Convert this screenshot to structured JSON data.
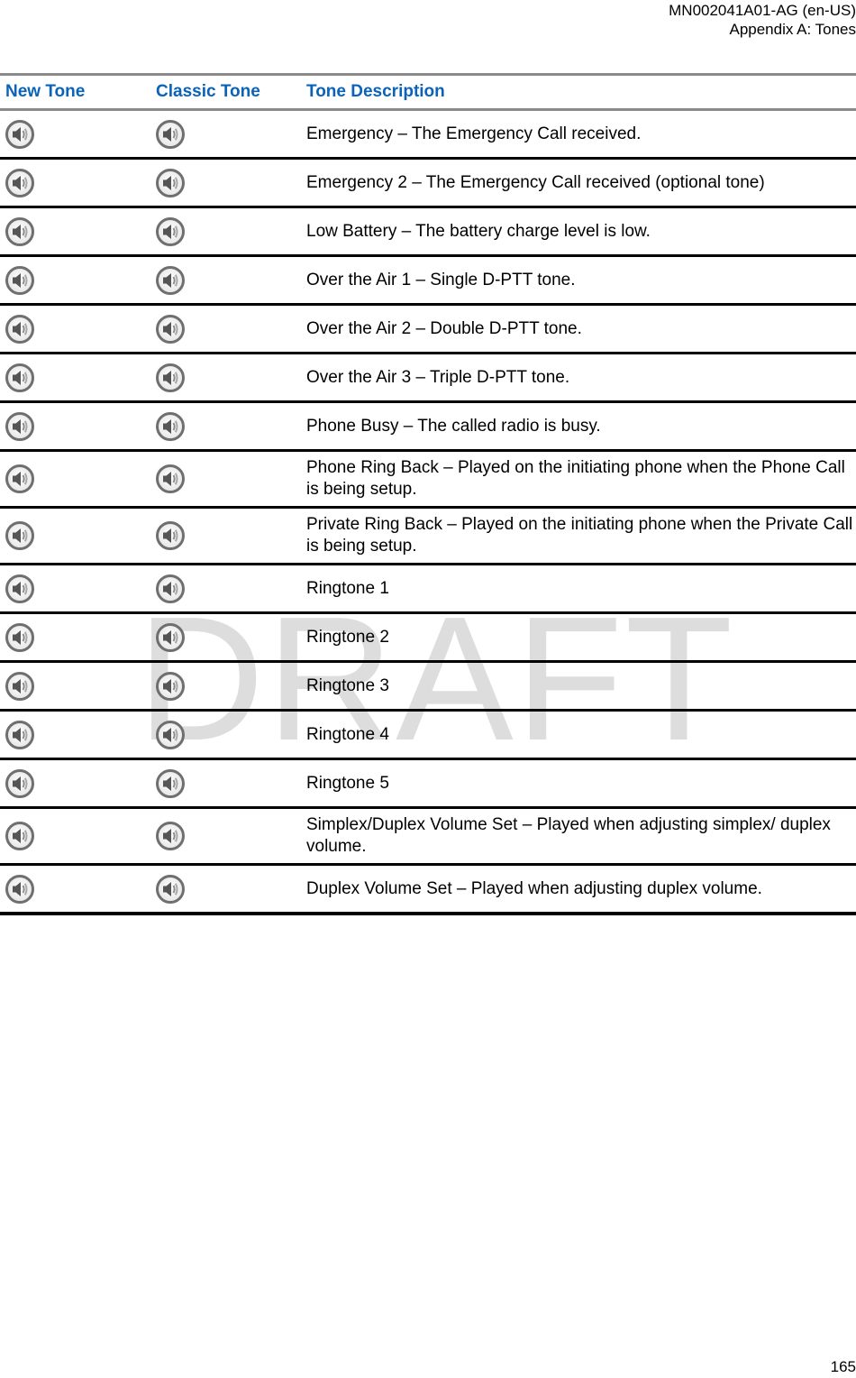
{
  "header": {
    "doc_id": "MN002041A01-AG (en-US)",
    "section": "Appendix A:  Tones"
  },
  "watermark": "DRAFT",
  "table": {
    "columns": [
      "New Tone",
      "Classic Tone",
      "Tone Description"
    ],
    "header_color": "#0a63b8",
    "icon": "speaker-play-icon",
    "rows": [
      {
        "description": "Emergency – The Emergency Call received.",
        "lines": 1
      },
      {
        "description": "Emergency 2 – The Emergency Call received (optional tone)",
        "lines": 1
      },
      {
        "description": "Low Battery – The battery charge level is low.",
        "lines": 1
      },
      {
        "description": "Over the Air 1 – Single D-PTT tone.",
        "lines": 1
      },
      {
        "description": "Over the Air 2 – Double D-PTT tone.",
        "lines": 1
      },
      {
        "description": "Over the Air 3 – Triple D-PTT tone.",
        "lines": 1
      },
      {
        "description": "Phone Busy – The called radio is busy.",
        "lines": 1
      },
      {
        "description": "Phone Ring Back – Played on the initiating phone when the Phone Call is being setup.",
        "lines": 2
      },
      {
        "description": "Private Ring Back – Played on the initiating phone when the Private Call is being setup.",
        "lines": 2
      },
      {
        "description": "Ringtone 1",
        "lines": 1
      },
      {
        "description": "Ringtone 2",
        "lines": 1
      },
      {
        "description": "Ringtone 3",
        "lines": 1
      },
      {
        "description": "Ringtone 4",
        "lines": 1
      },
      {
        "description": "Ringtone 5",
        "lines": 1
      },
      {
        "description": "Simplex/Duplex Volume Set – Played when adjusting simplex/ duplex volume.",
        "lines": 2
      },
      {
        "description": "Duplex Volume Set – Played when adjusting duplex volume.",
        "lines": 1
      }
    ]
  },
  "footer": {
    "page_number": "165"
  }
}
